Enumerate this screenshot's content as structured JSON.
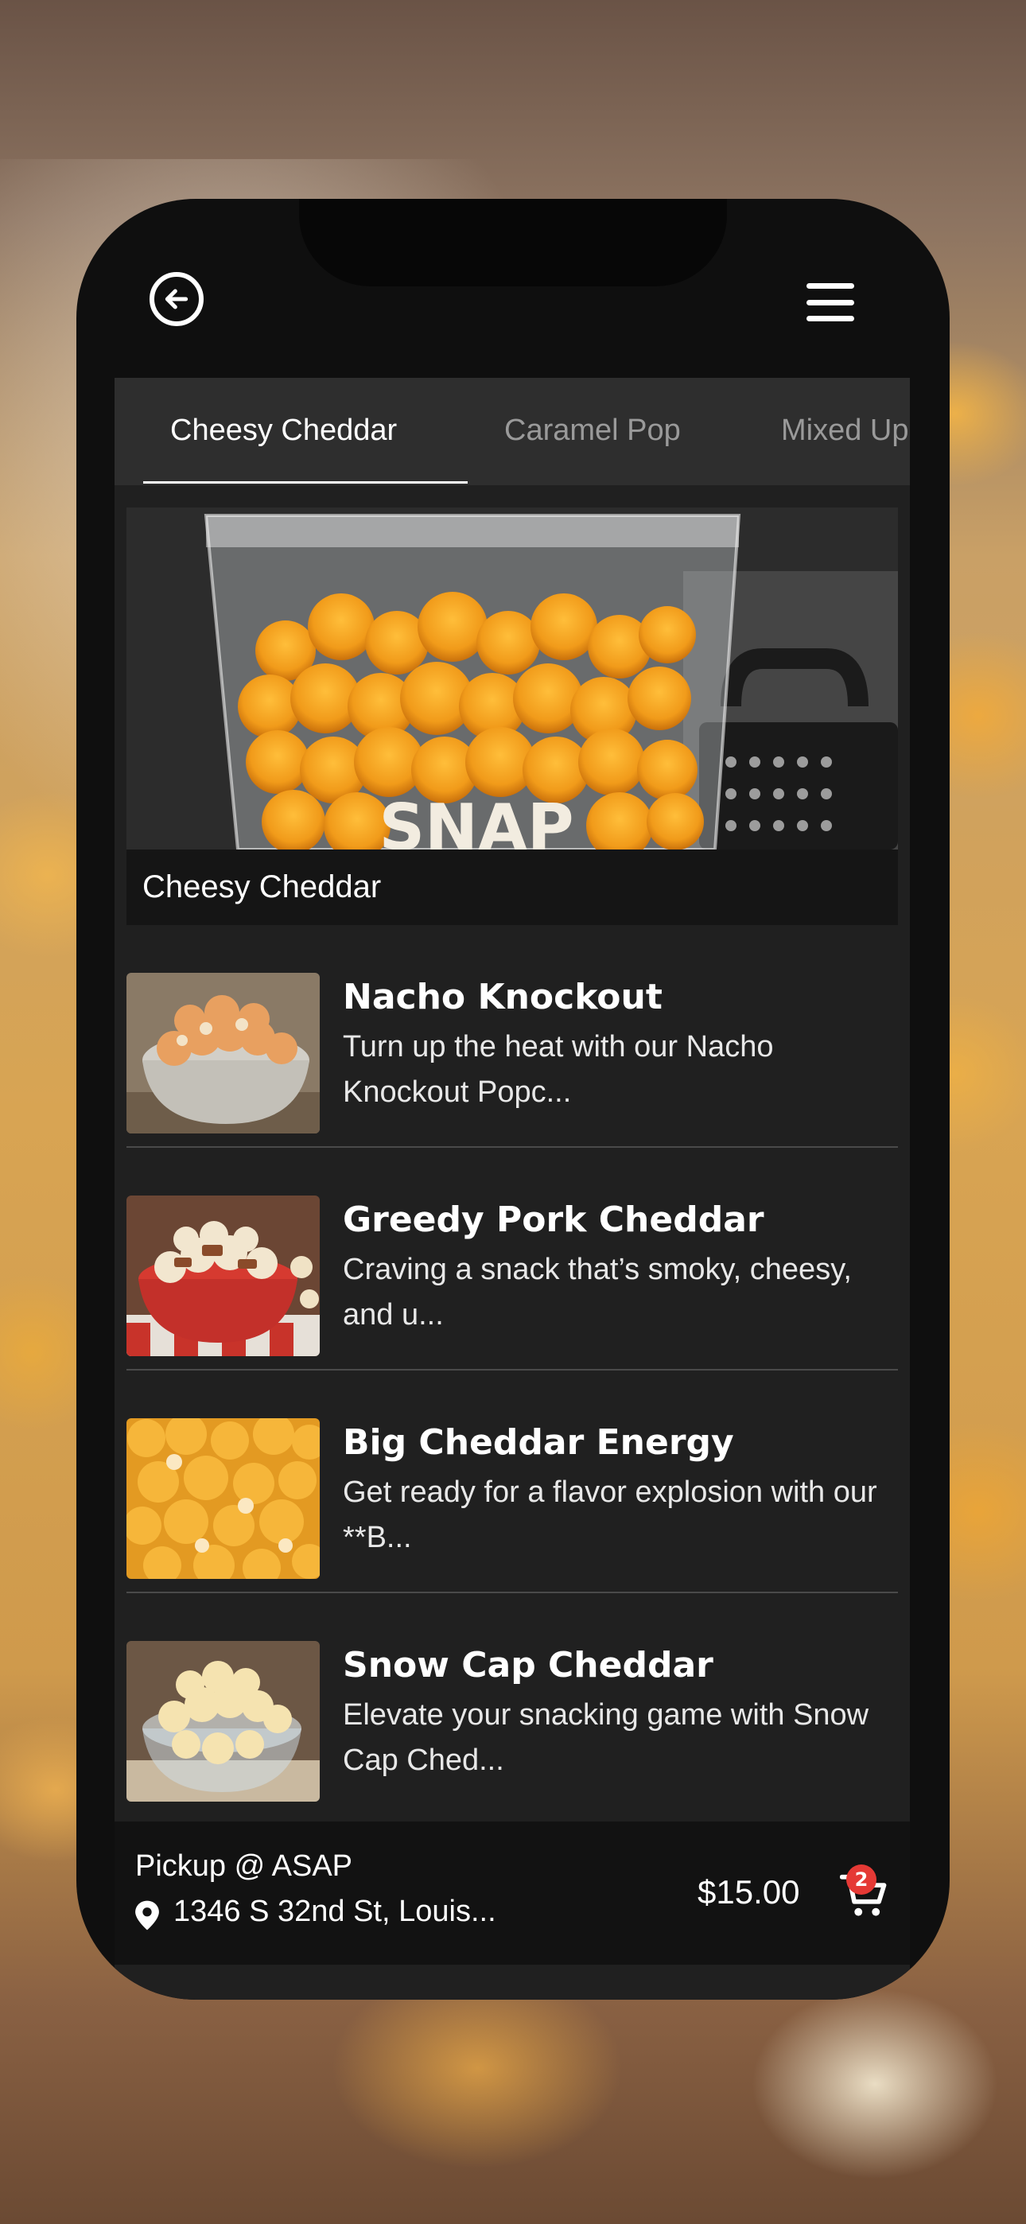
{
  "header": {
    "back_icon": "arrow-left-circle-icon",
    "menu_icon": "hamburger-menu-icon"
  },
  "tabs": [
    {
      "label": "Cheesy Cheddar",
      "active": true
    },
    {
      "label": "Caramel Pop",
      "active": false
    },
    {
      "label": "Mixed Up",
      "active": false
    }
  ],
  "hero": {
    "caption": "Cheesy Cheddar",
    "bag_print": "SNAP"
  },
  "products": [
    {
      "title": "Nacho Knockout",
      "description": "Turn up the heat with our Nacho Knockout Popc..."
    },
    {
      "title": "Greedy Pork Cheddar",
      "description": "Craving a snack that’s smoky, cheesy, and u..."
    },
    {
      "title": "Big Cheddar Energy",
      "description": "Get ready for a flavor explosion with our **B..."
    },
    {
      "title": "Snow Cap Cheddar",
      "description": "Elevate your snacking game with Snow Cap Ched..."
    }
  ],
  "footer": {
    "pickup_label": "Pickup @ ASAP",
    "address": "1346 S 32nd St, Louis...",
    "total": "$15.00",
    "cart_count": "2",
    "pin_icon": "location-pin-icon",
    "cart_icon": "shopping-cart-icon"
  },
  "colors": {
    "background": "#0f0f0f",
    "panel": "#202020",
    "tabbar": "#2e2e2e",
    "badge": "#e53935"
  }
}
